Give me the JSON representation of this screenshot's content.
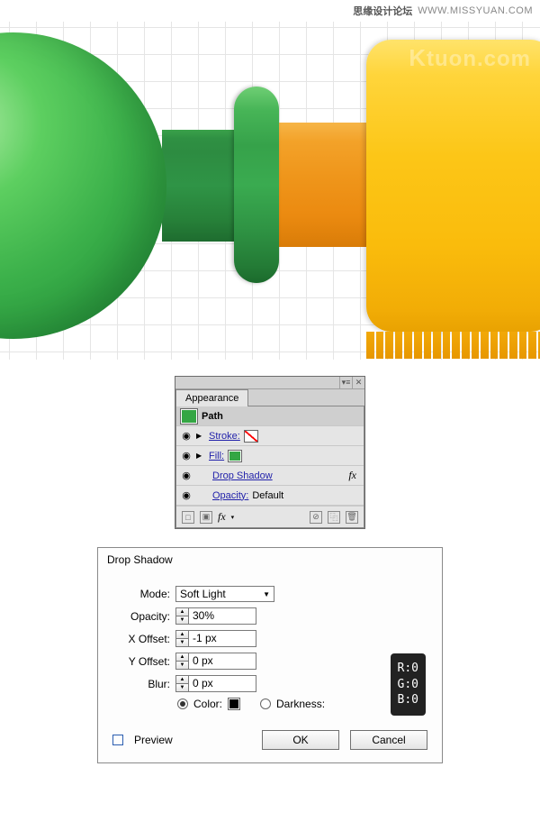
{
  "header": {
    "cn": "思缘设计论坛",
    "url": "WWW.MISSYUAN.COM"
  },
  "watermark": {
    "logo": "K",
    "text": "tuon.com"
  },
  "appearance": {
    "title": "Appearance",
    "path_label": "Path",
    "stroke_label": "Stroke:",
    "fill_label": "Fill:",
    "dropshadow_label": "Drop Shadow",
    "opacity_label": "Opacity:",
    "opacity_value": "Default",
    "fx_label": "fx",
    "footer_fx": "fx"
  },
  "dropshadow": {
    "title": "Drop Shadow",
    "mode_label": "Mode:",
    "mode_value": "Soft Light",
    "opacity_label": "Opacity:",
    "opacity_value": "30%",
    "xoffset_label": "X Offset:",
    "xoffset_value": "-1 px",
    "yoffset_label": "Y Offset:",
    "yoffset_value": "0 px",
    "blur_label": "Blur:",
    "blur_value": "0 px",
    "color_label": "Color:",
    "darkness_label": "Darkness:",
    "preview_label": "Preview",
    "ok": "OK",
    "cancel": "Cancel",
    "rgb": {
      "r": "R:0",
      "g": "G:0",
      "b": "B:0"
    }
  }
}
